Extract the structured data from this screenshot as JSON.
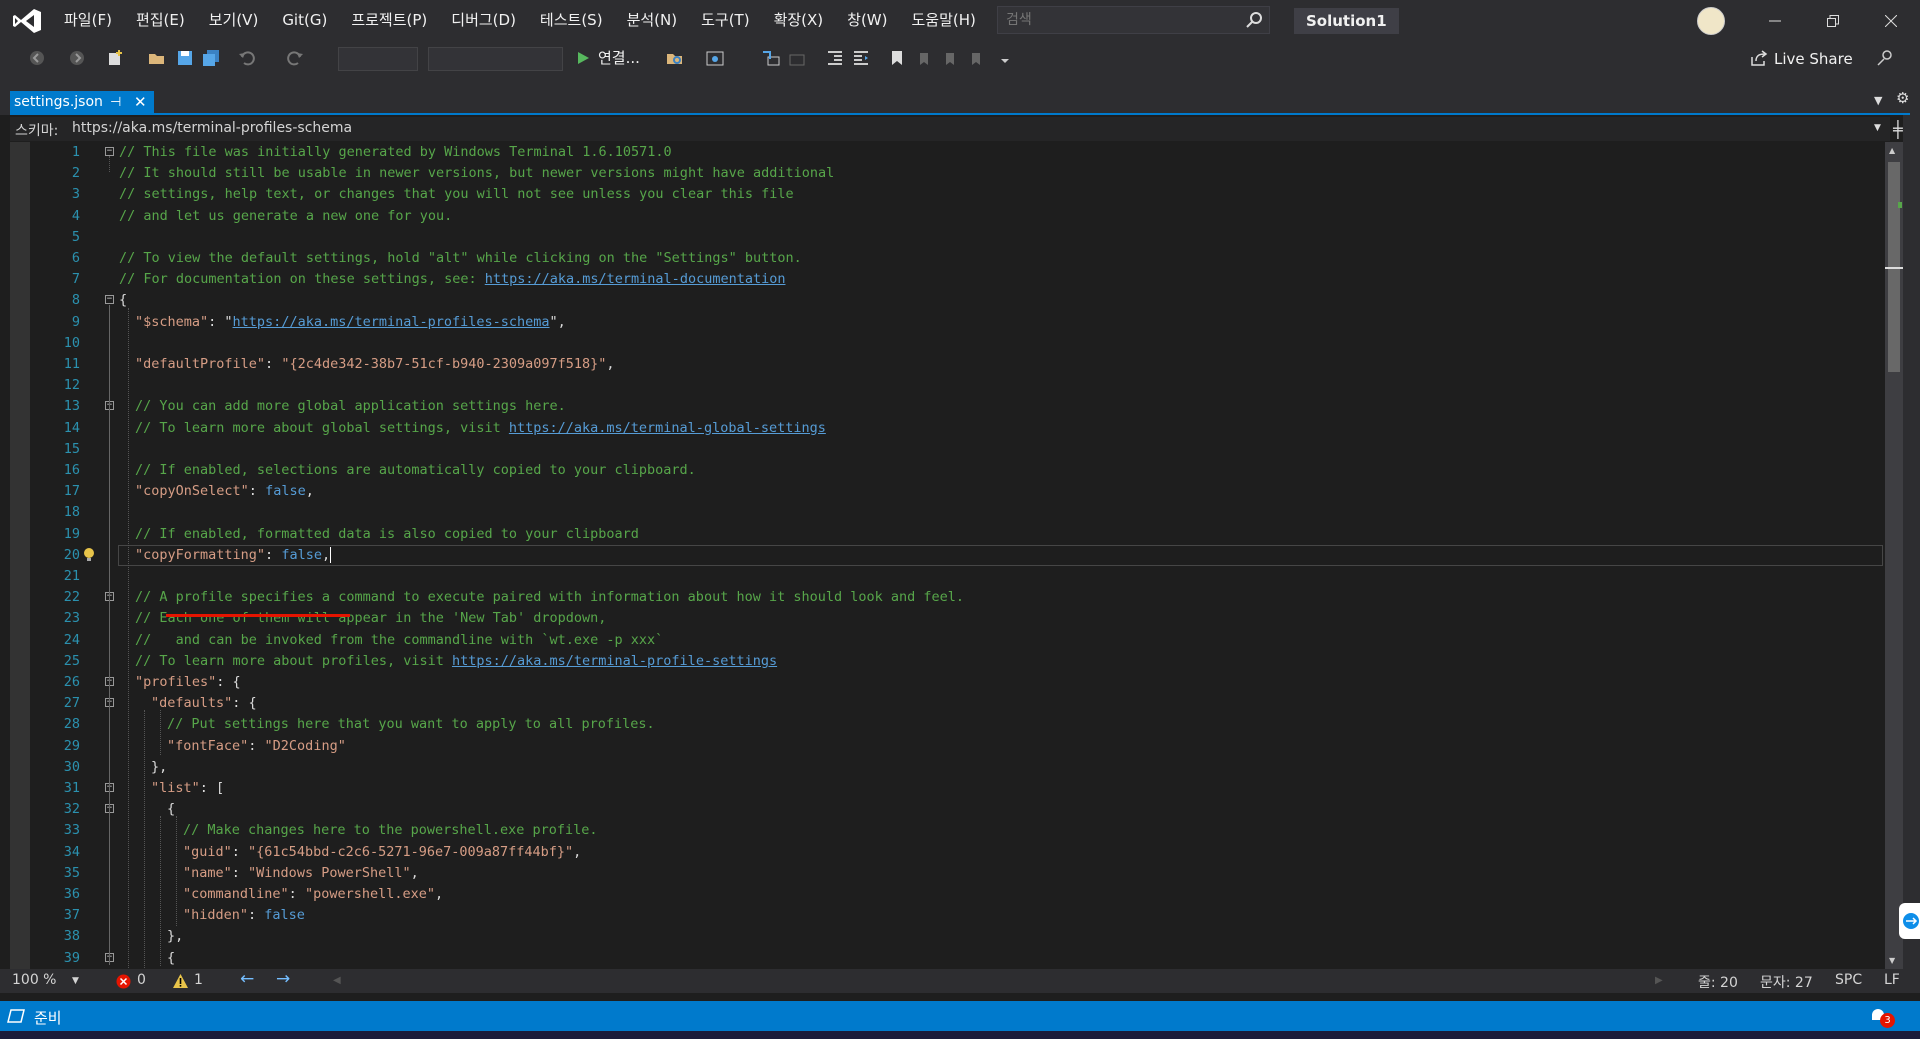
{
  "menu": [
    "파일(F)",
    "편집(E)",
    "보기(V)",
    "Git(G)",
    "프로젝트(P)",
    "디버그(D)",
    "테스트(S)",
    "분석(N)",
    "도구(T)",
    "확장(X)",
    "창(W)",
    "도움말(H)"
  ],
  "search": {
    "placeholder": "검색"
  },
  "solution_name": "Solution1",
  "toolbar": {
    "run_label": "연결...",
    "live_share": "Live Share"
  },
  "tab": {
    "label": "settings.json"
  },
  "schema": {
    "label": "스키마:",
    "value": "https://aka.ms/terminal-profiles-schema"
  },
  "status_text": "준비",
  "bottom": {
    "zoom": "100 %",
    "errors": "0",
    "warnings": "1",
    "line": "줄: 20",
    "char": "문자: 27",
    "spc": "SPC",
    "lf": "LF"
  },
  "notification_count": "3",
  "lines": [
    {
      "n": "1"
    },
    {
      "n": "2"
    },
    {
      "n": "3"
    },
    {
      "n": "4"
    },
    {
      "n": "5"
    },
    {
      "n": "6"
    },
    {
      "n": "7"
    },
    {
      "n": "8"
    },
    {
      "n": "9"
    },
    {
      "n": "10"
    },
    {
      "n": "11"
    },
    {
      "n": "12"
    },
    {
      "n": "13"
    },
    {
      "n": "14"
    },
    {
      "n": "15"
    },
    {
      "n": "16"
    },
    {
      "n": "17"
    },
    {
      "n": "18"
    },
    {
      "n": "19"
    },
    {
      "n": "20"
    },
    {
      "n": "21"
    },
    {
      "n": "22"
    },
    {
      "n": "23"
    },
    {
      "n": "24"
    },
    {
      "n": "25"
    },
    {
      "n": "26"
    },
    {
      "n": "27"
    },
    {
      "n": "28"
    },
    {
      "n": "29"
    },
    {
      "n": "30"
    },
    {
      "n": "31"
    },
    {
      "n": "32"
    },
    {
      "n": "33"
    },
    {
      "n": "34"
    },
    {
      "n": "35"
    },
    {
      "n": "36"
    },
    {
      "n": "37"
    },
    {
      "n": "38"
    },
    {
      "n": "39"
    }
  ],
  "code": {
    "l1": "// This file was initially generated by Windows Terminal 1.6.10571.0",
    "l2": "// It should still be usable in newer versions, but newer versions might have additional",
    "l3": "// settings, help text, or changes that you will not see unless you clear this file",
    "l4": "// and let us generate a new one for you.",
    "l6": "// To view the default settings, hold \"alt\" while clicking on the \"Settings\" button.",
    "l7a": "// For documentation on these settings, see: ",
    "l7b": "https://aka.ms/terminal-documentation",
    "l8": "{",
    "l9a": "\"$schema\"",
    "l9b": ": \"",
    "l9c": "https://aka.ms/terminal-profiles-schema",
    "l9d": "\",",
    "l11a": "\"defaultProfile\"",
    "l11b": ": ",
    "l11c": "\"{2c4de342-38b7-51cf-b940-2309a097f518}\"",
    "l11d": ",",
    "l13": "// You can add more global application settings here.",
    "l14a": "// To learn more about global settings, visit ",
    "l14b": "https://aka.ms/terminal-global-settings",
    "l16": "// If enabled, selections are automatically copied to your clipboard.",
    "l17a": "\"copyOnSelect\"",
    "l17b": ": ",
    "l17c": "false",
    "l17d": ",",
    "l19": "// If enabled, formatted data is also copied to your clipboard",
    "l20a": "\"copyFormatting\"",
    "l20b": ": ",
    "l20c": "false",
    "l20d": ",",
    "l22": "// A profile specifies a command to execute paired with information about how it should look and feel.",
    "l23": "// Each one of them will appear in the 'New Tab' dropdown,",
    "l24": "//   and can be invoked from the commandline with `wt.exe -p xxx`",
    "l25a": "// To learn more about profiles, visit ",
    "l25b": "https://aka.ms/terminal-profile-settings",
    "l26a": "\"profiles\"",
    "l26b": ": {",
    "l27a": "\"defaults\"",
    "l27b": ": {",
    "l28": "// Put settings here that you want to apply to all profiles.",
    "l29a": "\"fontFace\"",
    "l29b": ": ",
    "l29c": "\"D2Coding\"",
    "l30": "},",
    "l31a": "\"list\"",
    "l31b": ": [",
    "l32": "{",
    "l33": "// Make changes here to the powershell.exe profile.",
    "l34a": "\"guid\"",
    "l34b": ": ",
    "l34c": "\"{61c54bbd-c2c6-5271-96e7-009a87ff44bf}\"",
    "l34d": ",",
    "l35a": "\"name\"",
    "l35b": ": ",
    "l35c": "\"Windows PowerShell\"",
    "l35d": ",",
    "l36a": "\"commandline\"",
    "l36b": ": ",
    "l36c": "\"powershell.exe\"",
    "l36d": ",",
    "l37a": "\"hidden\"",
    "l37b": ": ",
    "l37c": "false",
    "l38": "},",
    "l39": "{"
  }
}
